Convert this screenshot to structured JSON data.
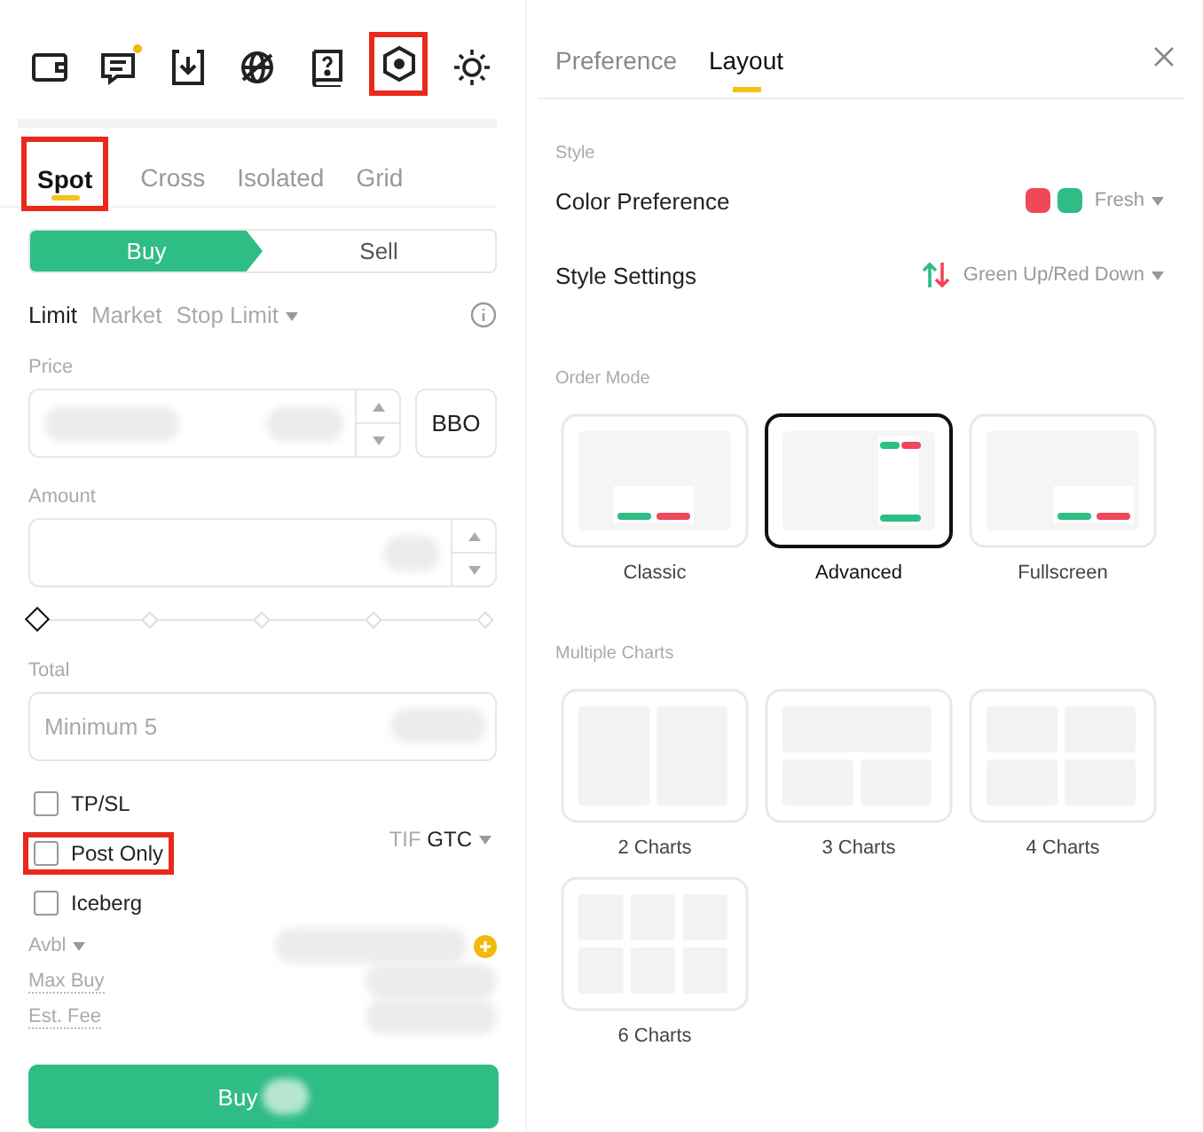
{
  "toolbar": [
    {
      "kind": "wallet",
      "badge": false,
      "highlighted": false
    },
    {
      "kind": "chat",
      "badge": true,
      "highlighted": false
    },
    {
      "kind": "download",
      "badge": false,
      "highlighted": false
    },
    {
      "kind": "globe",
      "badge": false,
      "highlighted": false
    },
    {
      "kind": "book",
      "badge": false,
      "highlighted": false
    },
    {
      "kind": "hexagon",
      "badge": false,
      "highlighted": true
    },
    {
      "kind": "sun",
      "badge": false,
      "highlighted": false
    }
  ],
  "trade_tabs": [
    {
      "label": "Spot",
      "selected": true,
      "highlighted": true
    },
    {
      "label": "Cross",
      "selected": false,
      "highlighted": false
    },
    {
      "label": "Isolated",
      "selected": false,
      "highlighted": false
    },
    {
      "label": "Grid",
      "selected": false,
      "highlighted": false
    }
  ],
  "side_toggle": [
    {
      "label": "Buy",
      "selected": true
    },
    {
      "label": "Sell",
      "selected": false
    }
  ],
  "order_types": [
    {
      "label": "Limit",
      "selected": true,
      "dropdown": false
    },
    {
      "label": "Market",
      "selected": false,
      "dropdown": false
    },
    {
      "label": "Stop Limit",
      "selected": false,
      "dropdown": true
    }
  ],
  "price": {
    "label": "Price",
    "button": "BBO"
  },
  "amount": {
    "label": "Amount",
    "level": 0
  },
  "total": {
    "label": "Total",
    "placeholder": "Minimum 5"
  },
  "options": [
    {
      "label": "TP/SL",
      "checked": false,
      "highlighted": false
    },
    {
      "label": "Post Only",
      "checked": false,
      "highlighted": true
    },
    {
      "label": "Iceberg",
      "checked": false,
      "highlighted": false
    }
  ],
  "tif": {
    "label": "TIF",
    "value": "GTC"
  },
  "info_rows": [
    {
      "label": "Avbl",
      "dropdown": true,
      "add_button": true
    },
    {
      "label": "Max Buy",
      "dropdown": false,
      "add_button": false
    },
    {
      "label": "Est. Fee",
      "dropdown": false,
      "add_button": false
    }
  ],
  "submit": {
    "label": "Buy"
  },
  "settings": {
    "tabs": [
      {
        "label": "Preference",
        "selected": false
      },
      {
        "label": "Layout",
        "selected": true
      }
    ],
    "style_heading": "Style",
    "style_rows": [
      {
        "kind": "swatches",
        "label": "Color Preference",
        "value": "Fresh",
        "swatches": [
          {
            "color": "#f0475a"
          },
          {
            "color": "#2ebd85"
          }
        ]
      },
      {
        "kind": "arrows",
        "label": "Style Settings",
        "value": "Green Up/Red Down"
      }
    ],
    "order_mode_heading": "Order Mode",
    "order_modes": [
      {
        "kind": "classic",
        "label": "Classic",
        "selected": false
      },
      {
        "kind": "advanced",
        "label": "Advanced",
        "selected": true
      },
      {
        "kind": "fullscreen",
        "label": "Fullscreen",
        "selected": false
      }
    ],
    "charts_heading": "Multiple Charts",
    "chart_layouts": [
      {
        "kind": "two",
        "label": "2 Charts",
        "selected": false
      },
      {
        "kind": "three",
        "label": "3 Charts",
        "selected": false
      },
      {
        "kind": "four",
        "label": "4 Charts",
        "selected": false
      },
      {
        "kind": "six",
        "label": "6 Charts",
        "selected": false
      }
    ]
  }
}
